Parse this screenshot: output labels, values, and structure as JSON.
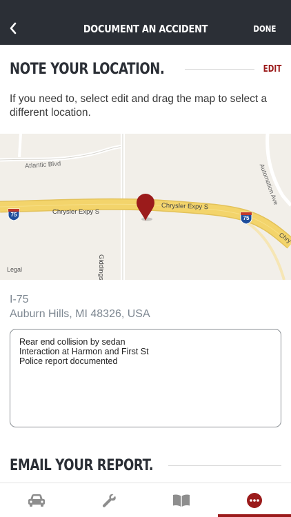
{
  "header": {
    "title": "DOCUMENT AN ACCIDENT",
    "done_label": "DONE",
    "back_icon": "chevron-left-icon"
  },
  "location_section": {
    "title": "NOTE YOUR LOCATION.",
    "edit_label": "EDIT",
    "instructions": "If you need to, select edit and drag the map to select a different location."
  },
  "map": {
    "roads": [
      "Atlantic Blvd",
      "Chrysler Expy S",
      "Chrysler Expy S",
      "Giddings Rd",
      "Automation Ave",
      "Chry"
    ],
    "highway_shields": [
      "75",
      "75"
    ],
    "legal_label": "Legal",
    "pin_color": "#9b1b1b",
    "highway_color": "#f3d46b"
  },
  "address": {
    "line1": "I-75",
    "line2": "Auburn Hills, MI 48326, USA"
  },
  "notes": {
    "lines": [
      "Rear end collision by sedan",
      "Interaction at Harmon and First St",
      "Police report documented"
    ]
  },
  "email_section": {
    "title": "EMAIL YOUR REPORT."
  },
  "tabbar": {
    "tabs": [
      {
        "icon": "car-icon",
        "selected": false
      },
      {
        "icon": "wrench-icon",
        "selected": false
      },
      {
        "icon": "book-icon",
        "selected": false
      },
      {
        "icon": "more-icon",
        "selected": true
      }
    ],
    "accent": "#9b1b1b"
  }
}
